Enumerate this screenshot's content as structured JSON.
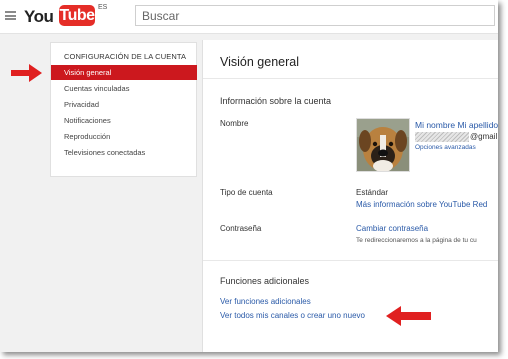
{
  "colors": {
    "brand_red": "#cc181e",
    "link_blue": "#2a5aa8",
    "arrow_red": "#e02020"
  },
  "header": {
    "logo_you": "You",
    "logo_tube": "Tube",
    "logo_region": "ES",
    "search_placeholder": "Buscar",
    "menu_icon": "hamburger-icon"
  },
  "sidebar": {
    "header": "CONFIGURACIÓN DE LA CUENTA",
    "items": [
      {
        "label": "Visión general",
        "active": true
      },
      {
        "label": "Cuentas vinculadas"
      },
      {
        "label": "Privacidad"
      },
      {
        "label": "Notificaciones"
      },
      {
        "label": "Reproducción"
      },
      {
        "label": "Televisiones conectadas"
      }
    ]
  },
  "main": {
    "title": "Visión general",
    "account_section": {
      "title": "Información sobre la cuenta",
      "name_label": "Nombre",
      "account_name": "Mi nombre Mi apellido",
      "email_suffix": "@gmail.com",
      "advanced_options": "Opciones avanzadas",
      "account_type_label": "Tipo de cuenta",
      "account_type_value": "Estándar",
      "more_info_link": "Más información sobre YouTube Red",
      "password_label": "Contraseña",
      "change_password_link": "Cambiar contraseña",
      "redirect_note": "Te redireccionaremos a la página de tu cu"
    },
    "additional": {
      "title": "Funciones adicionales",
      "see_features_link": "Ver funciones adicionales",
      "channels_link": "Ver todos mis canales o crear uno nuevo"
    }
  }
}
